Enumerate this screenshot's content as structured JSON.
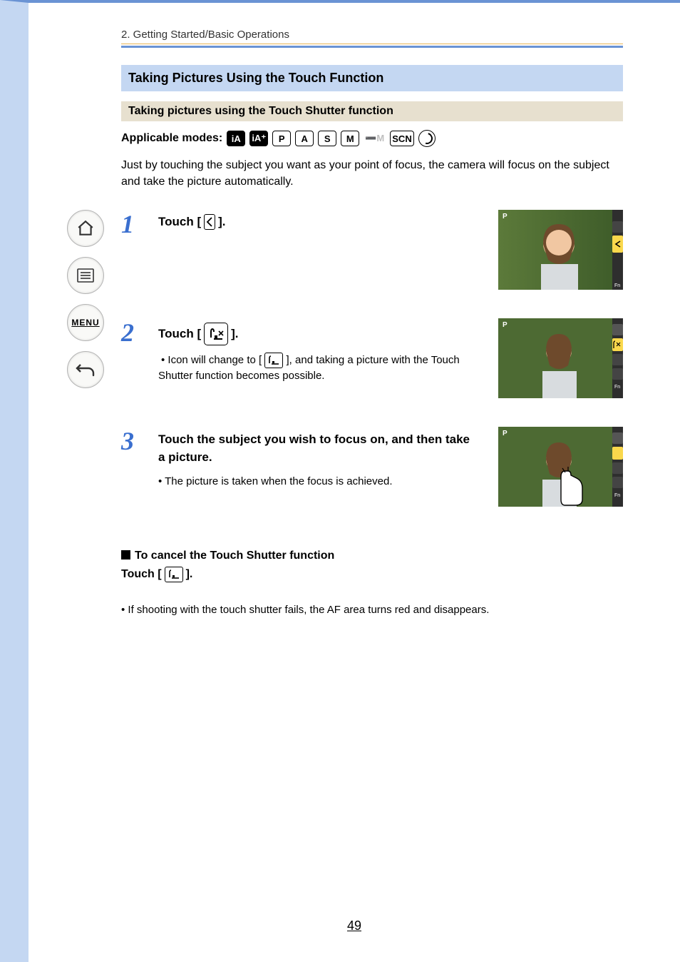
{
  "chapter": "2. Getting Started/Basic Operations",
  "heading_main": "Taking Pictures Using the Touch Function",
  "heading_sub": "Taking pictures using the Touch Shutter function",
  "applicable_label": "Applicable modes:",
  "modes": {
    "ia": "iA",
    "ia_plus": "iA⁺",
    "p": "P",
    "a": "A",
    "s": "S",
    "m": "M",
    "movie": "➖M",
    "scn": "SCN"
  },
  "intro": "Just by touching the subject you want as your point of focus, the camera will focus on the subject and take the picture automatically.",
  "steps": [
    {
      "num": "1",
      "title_prefix": "Touch [",
      "title_suffix": "]."
    },
    {
      "num": "2",
      "title_prefix": "Touch [",
      "title_suffix": "].",
      "sub_prefix": "• Icon will change to [",
      "sub_suffix": "], and taking a picture with the Touch Shutter function becomes possible."
    },
    {
      "num": "3",
      "title": "Touch the subject you wish to focus on, and then take a picture.",
      "sub": "• The picture is taken when the focus is achieved."
    }
  ],
  "cancel_heading": "To cancel the Touch Shutter function",
  "cancel_action_prefix": "Touch [",
  "cancel_action_suffix": "].",
  "note": "• If shooting with the touch shutter fails, the AF area turns red and disappears.",
  "page_number": "49",
  "sidebar": {
    "menu_label": "MENU"
  }
}
